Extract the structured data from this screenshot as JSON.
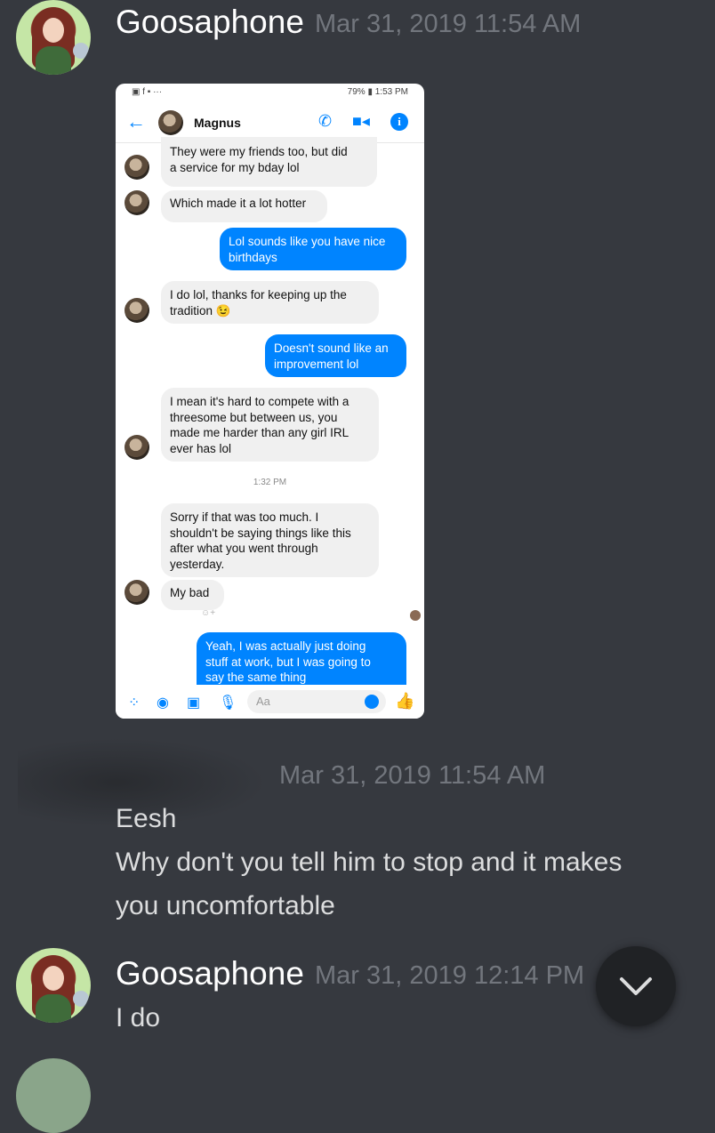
{
  "messages": [
    {
      "username": "Goosaphone",
      "timestamp": "Mar 31, 2019 11:54 AM"
    },
    {
      "timestamp": "Mar 31, 2019 11:54 AM",
      "lines": [
        "Eesh",
        "Why don't you tell him to stop and it makes",
        "you uncomfortable"
      ]
    },
    {
      "username": "Goosaphone",
      "timestamp": "Mar 31, 2019 12:14 PM",
      "lines": [
        "I do"
      ]
    }
  ],
  "screenshot": {
    "status_left": "▣ f ▪ ···",
    "status_right": "79% ▮ 1:53 PM",
    "contact_name": "Magnus",
    "bubbles": [
      {
        "side": "in",
        "text": "They were my friends too, but did\na service for my bday lol"
      },
      {
        "side": "in",
        "text": "Which made it a lot hotter"
      },
      {
        "side": "out",
        "text": "Lol sounds like you have nice\nbirthdays"
      },
      {
        "side": "in",
        "text": "I do lol, thanks for keeping up the\ntradition 😉"
      },
      {
        "side": "out",
        "text": "Doesn't sound like an\nimprovement lol"
      },
      {
        "side": "in",
        "text": "I mean it's hard to compete with a\nthreesome but between us, you\nmade me harder than any girl IRL\never has lol"
      },
      {
        "side": "in",
        "text": "Sorry if that was too much. I\nshouldn't be saying things like this\nafter what you went through\nyesterday."
      },
      {
        "side": "in",
        "text": "My bad"
      },
      {
        "side": "out",
        "text": "Yeah, I was actually just doing\nstuff at work, but I was going to\nsay the same thing"
      }
    ],
    "time_separator": "1:32 PM",
    "reaction_placeholder": "☺+",
    "composer_placeholder": "Aa"
  },
  "colors": {
    "background": "#36393f",
    "accent": "#0084ff",
    "jump_button": "#202225"
  },
  "icons": [
    "back-arrow-icon",
    "phone-icon",
    "video-icon",
    "info-icon",
    "apps-icon",
    "camera-icon",
    "image-icon",
    "mic-icon",
    "emoji-icon",
    "thumbs-up-icon",
    "chevron-down-icon"
  ]
}
